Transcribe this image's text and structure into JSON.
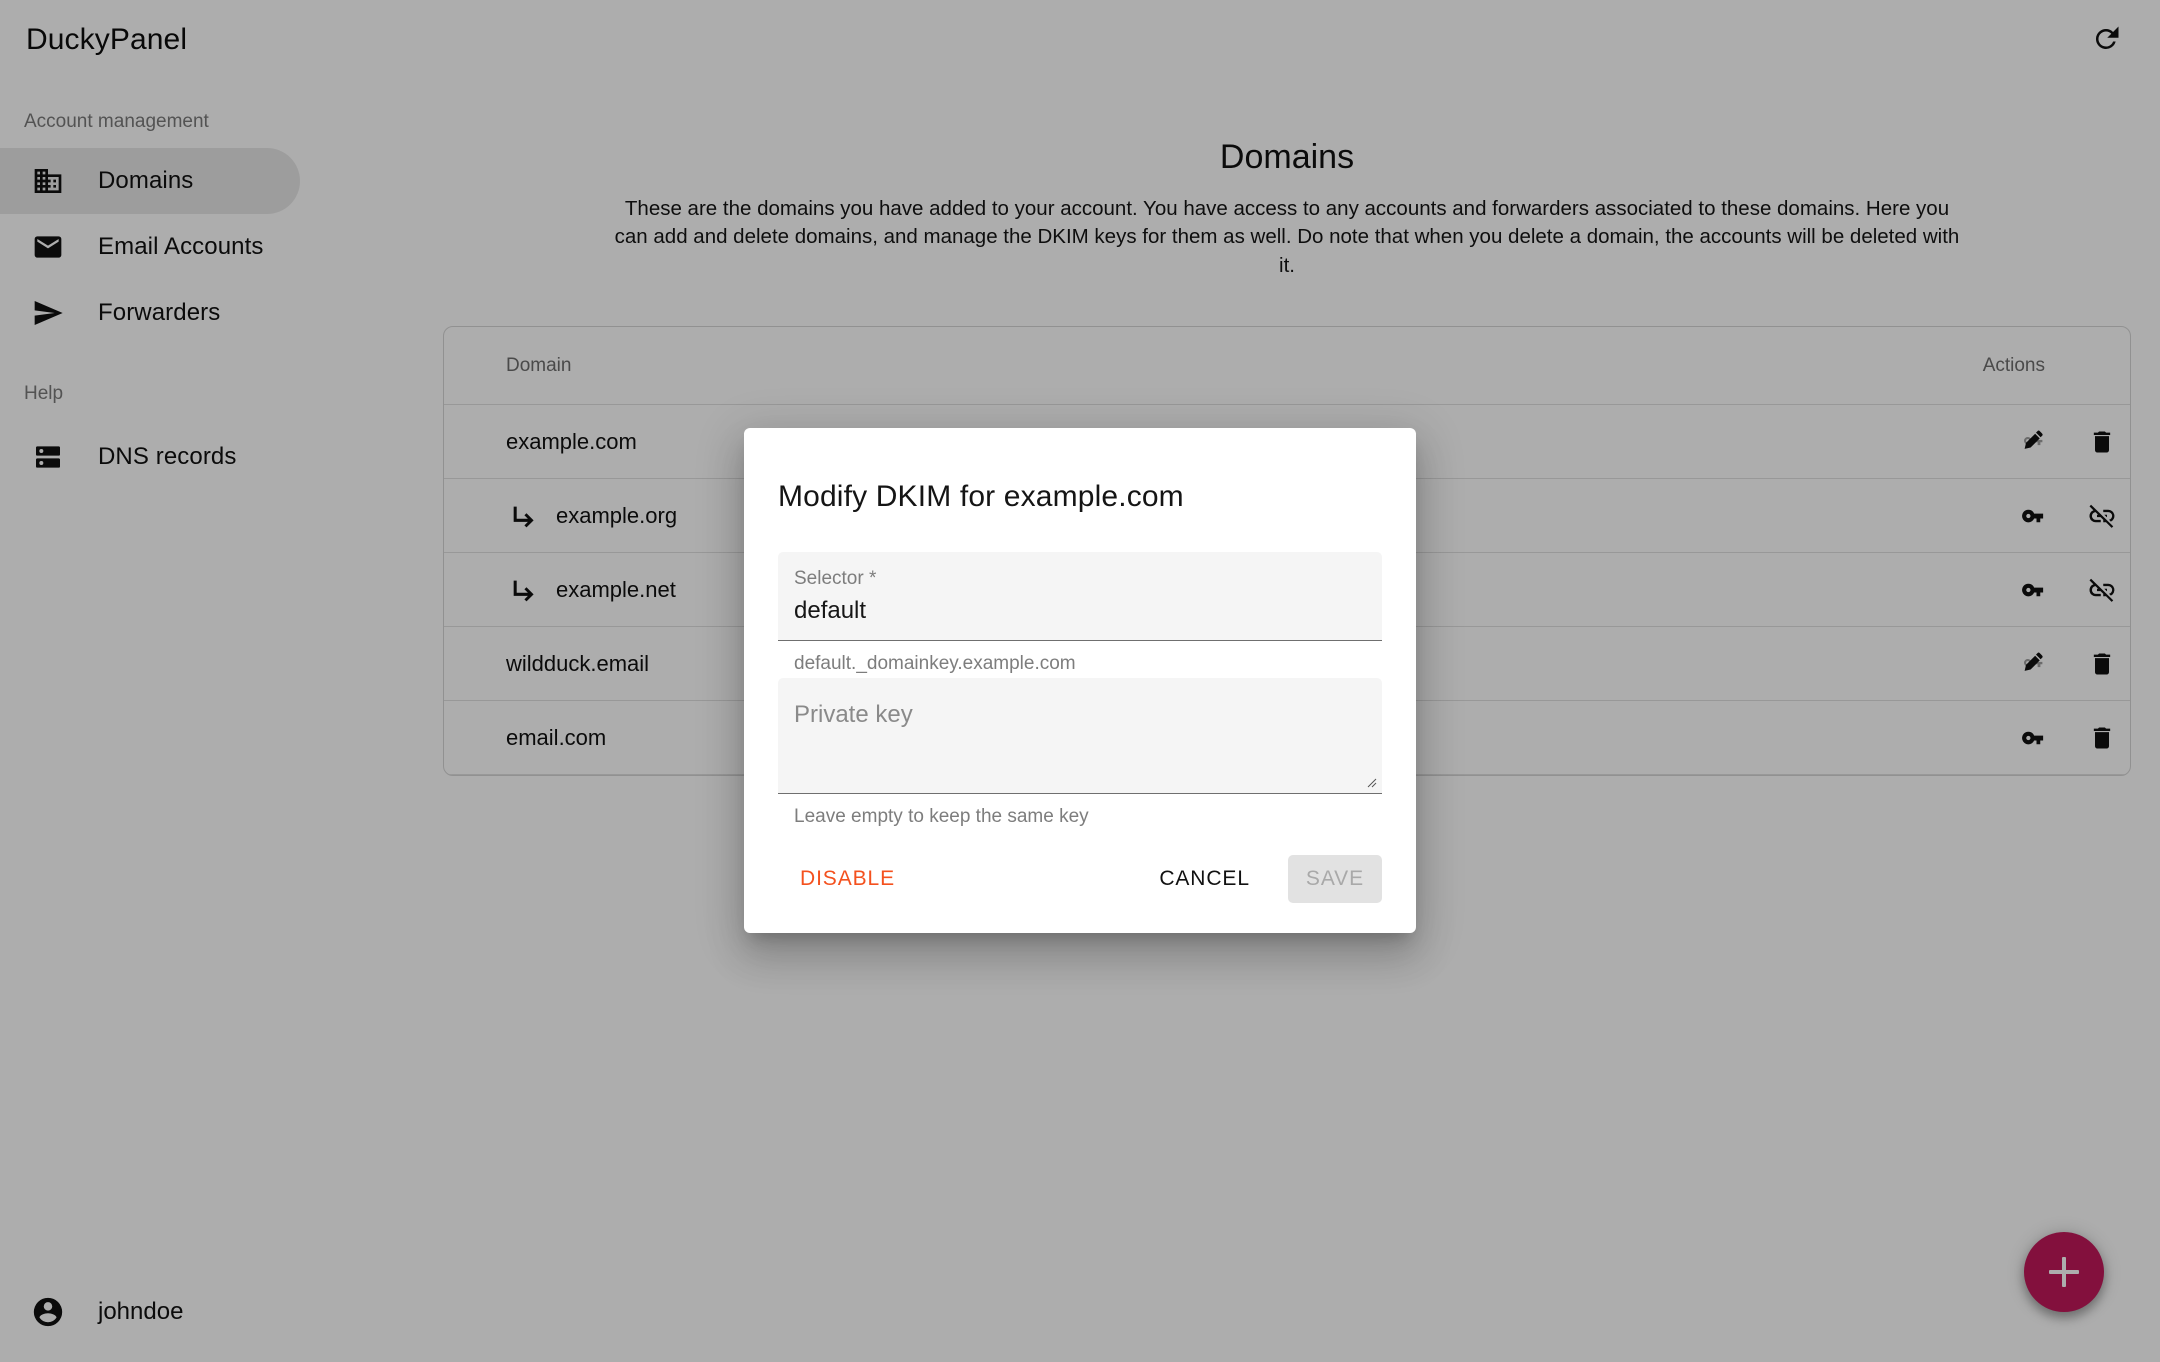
{
  "app": {
    "title": "DuckyPanel",
    "refresh_icon": "refresh-icon"
  },
  "sidebar": {
    "sections": [
      {
        "label": "Account management"
      },
      {
        "label": "Help"
      }
    ],
    "items": [
      {
        "label": "Domains",
        "icon": "domain-building-icon",
        "active": true
      },
      {
        "label": "Email Accounts",
        "icon": "envelope-icon",
        "active": false
      },
      {
        "label": "Forwarders",
        "icon": "send-arrow-icon",
        "active": false
      },
      {
        "label": "DNS records",
        "icon": "dns-server-icon",
        "active": false
      }
    ],
    "user": {
      "name": "johndoe",
      "icon": "account-circle-icon"
    }
  },
  "main": {
    "page_title": "Domains",
    "page_description": "These are the domains you have added to your account. You have access to any accounts and forwarders associated to these domains. Here you can add and delete domains, and manage the DKIM keys for them as well. Do note that when you delete a domain, the accounts will be deleted with it.",
    "table": {
      "columns": [
        "Domain",
        "Actions"
      ],
      "rows": [
        {
          "domain": "example.com",
          "is_alias": false,
          "actions": [
            "edit-dkim-key-icon",
            "delete-icon"
          ]
        },
        {
          "domain": "example.org",
          "is_alias": true,
          "actions": [
            "dkim-key-icon",
            "link-off-icon"
          ]
        },
        {
          "domain": "example.net",
          "is_alias": true,
          "actions": [
            "dkim-key-icon",
            "link-off-icon"
          ]
        },
        {
          "domain": "wildduck.email",
          "is_alias": false,
          "actions": [
            "edit-dkim-key-icon",
            "delete-icon"
          ]
        },
        {
          "domain": "email.com",
          "is_alias": false,
          "actions": [
            "dkim-key-icon",
            "delete-icon"
          ]
        }
      ]
    },
    "fab": {
      "label": "+",
      "icon": "plus-icon",
      "color": "#c2185b"
    }
  },
  "dialog": {
    "title": "Modify DKIM for example.com",
    "selector_field": {
      "label": "Selector *",
      "value": "default",
      "hint": "default._domainkey.example.com"
    },
    "private_key_field": {
      "placeholder": "Private key",
      "value": "",
      "hint": "Leave empty to keep the same key"
    },
    "buttons": {
      "disable": "DISABLE",
      "cancel": "CANCEL",
      "save": "SAVE"
    },
    "colors": {
      "disable": "#f4511e",
      "save_disabled_bg": "#e2e2e2",
      "save_disabled_text": "#a9a9a9"
    }
  }
}
